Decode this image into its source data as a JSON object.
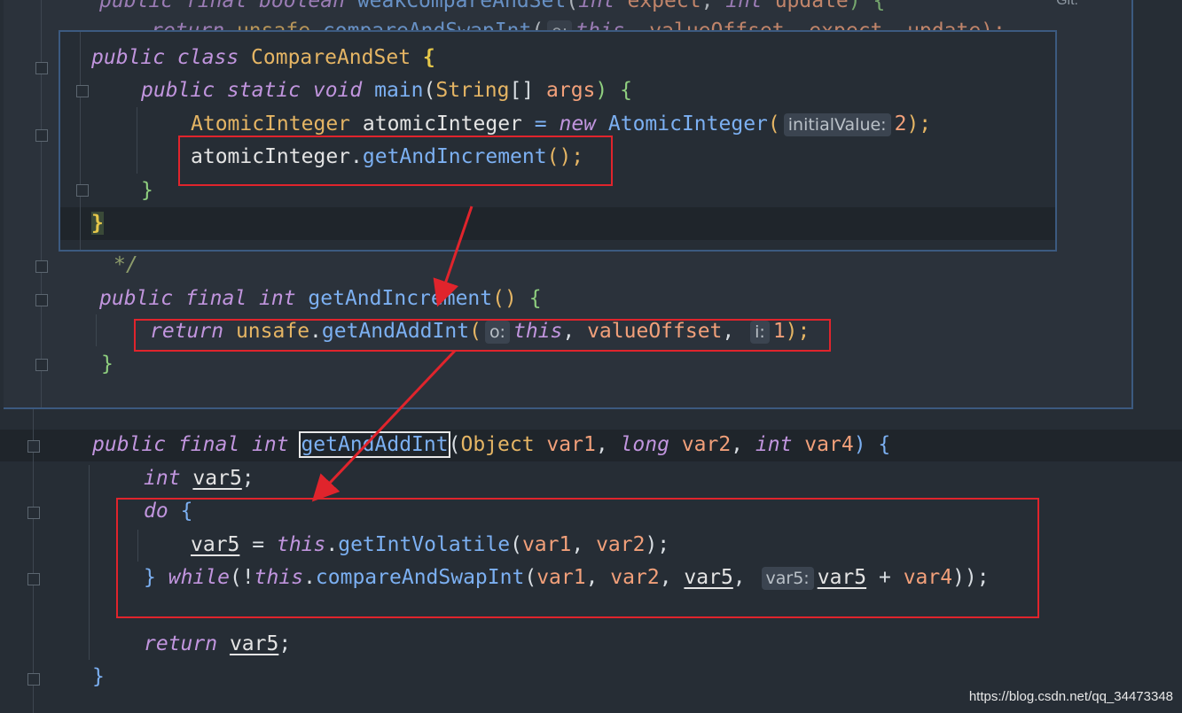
{
  "top_code": {
    "line1": {
      "kw": "public final boolean",
      "fn": "weakCompareAndSet",
      "p1kw": "int",
      "p1": "expect",
      "p2kw": "int",
      "p2": "update",
      "end": ") {"
    },
    "line2": {
      "kw": "return",
      "obj": "unsafe",
      "fn": "compareAndSwapInt",
      "hint": "o:",
      "this": "this",
      "rest": ", valueOffset, expect, update);"
    },
    "right_hint": "Git:"
  },
  "inner_popup": {
    "line1": {
      "kw": "public class",
      "type": "CompareAndSet",
      "brace": "{"
    },
    "line2": {
      "kw": "public static void",
      "fn": "main",
      "open": "(",
      "type": "String",
      "arr": "[]",
      "param": "args",
      "close": ") {"
    },
    "line3": {
      "type": "AtomicInteger",
      "var": "atomicInteger",
      "eq": "=",
      "kw": "new",
      "ctor": "AtomicInteger",
      "open": "(",
      "hint": "initialValue:",
      "num": "2",
      "close": ");"
    },
    "line4": {
      "var": "atomicInteger",
      "dot": ".",
      "fn": "getAndIncrement",
      "call": "();"
    },
    "line5": {
      "brace": "}"
    },
    "line6": {
      "brace": "}"
    }
  },
  "outer_popup": {
    "comment_end": "*/",
    "decl": {
      "kw": "public final int",
      "fn": "getAndIncrement",
      "paren": "()",
      "brace": "{"
    },
    "ret": {
      "kw": "return",
      "obj": "unsafe",
      "dot": ".",
      "fn": "getAndAddInt",
      "open": "(",
      "hint_o": "o:",
      "this": "this",
      "comma1": ",",
      "offset": "valueOffset",
      "comma2": ",",
      "hint_i": "i:",
      "num": "1",
      "close": ");"
    },
    "close": "}"
  },
  "main_code": {
    "decl": {
      "kw1": "public final",
      "kw2": "int",
      "fn": "getAndAddInt",
      "open": "(",
      "t1": "Object",
      "p1": "var1",
      "c1": ",",
      "t2": "long",
      "p2": "var2",
      "c2": ",",
      "t3": "int",
      "p3": "var4",
      "close": ") {"
    },
    "l2": {
      "kw": "int",
      "var": "var5",
      "semi": ";"
    },
    "l3": {
      "kw": "do",
      "brace": "{"
    },
    "l4": {
      "var": "var5",
      "eq": "=",
      "this": "this",
      "dot": ".",
      "fn": "getIntVolatile",
      "open": "(",
      "a1": "var1",
      "c": ",",
      "a2": "var2",
      "close": ");"
    },
    "l5": {
      "brace": "}",
      "kw": "while",
      "open": "(!",
      "this": "this",
      "dot": ".",
      "fn": "compareAndSwapInt",
      "paren": "(",
      "a1": "var1",
      "c1": ",",
      "a2": "var2",
      "c2": ",",
      "a3": "var5",
      "c3": ",",
      "hint": "var5:",
      "a4": "var5",
      "plus": "+",
      "a5": "var4",
      "close": "));"
    },
    "l7": {
      "kw": "return",
      "var": "var5",
      "semi": ";"
    },
    "l8": {
      "brace": "}"
    }
  },
  "colors": {
    "annotation_red": "#e0242c",
    "popup_border": "#3c5a80",
    "background": "#262d35"
  },
  "watermark": "https://blog.csdn.net/qq_34473348"
}
